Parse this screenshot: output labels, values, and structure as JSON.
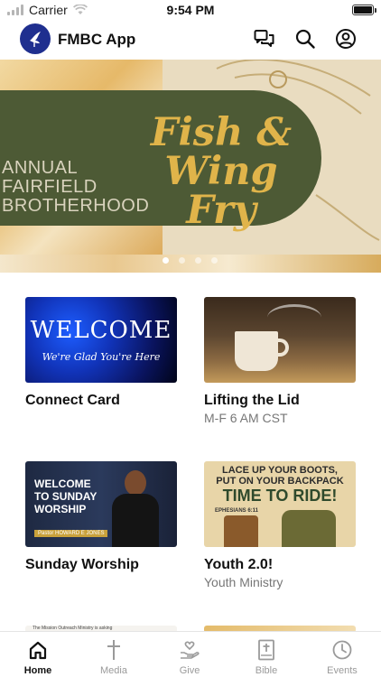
{
  "status_bar": {
    "carrier": "Carrier",
    "time": "9:54 PM"
  },
  "header": {
    "title": "FMBC App",
    "icons": [
      "chat-icon",
      "search-icon",
      "account-icon"
    ]
  },
  "banner": {
    "line1": "ANNUAL",
    "line2": "FAIRFIELD",
    "line3": "BROTHERHOOD",
    "title_line1": "Fish &",
    "title_line2": "Wing",
    "title_line3": "Fry",
    "page_count": 4,
    "active_page": 1,
    "colors": {
      "pill": "#4d5a35",
      "title": "#e0b44a"
    }
  },
  "cards": [
    {
      "title": "Connect Card",
      "subtitle": "",
      "thumb_text": "WELCOME",
      "thumb_subtext": "We're Glad You're Here"
    },
    {
      "title": "Lifting the Lid",
      "subtitle": "M-F 6 AM CST"
    },
    {
      "title": "Sunday Worship",
      "subtitle": "",
      "thumb_line1": "WELCOME",
      "thumb_line2": "TO SUNDAY",
      "thumb_line3": "WORSHIP",
      "thumb_tag": "Pastor HOWARD E JONES"
    },
    {
      "title": "Youth 2.0!",
      "subtitle": "Youth Ministry",
      "thumb_line1": "LACE UP YOUR BOOTS,",
      "thumb_line1b": "PUT ON YOUR BACKPACK",
      "thumb_line2": "TIME TO RIDE!",
      "thumb_line3": "EPHESIANS 6:11"
    },
    {
      "thumb_text": "The Mission Outreach Ministry is asking"
    }
  ],
  "tabs": [
    {
      "label": "Home",
      "icon": "home-icon",
      "active": true
    },
    {
      "label": "Media",
      "icon": "cross-icon",
      "active": false
    },
    {
      "label": "Give",
      "icon": "give-icon",
      "active": false
    },
    {
      "label": "Bible",
      "icon": "bible-icon",
      "active": false
    },
    {
      "label": "Events",
      "icon": "clock-icon",
      "active": false
    }
  ],
  "colors": {
    "logo_bg": "#1f2f8f",
    "tab_inactive": "#9a9a9a",
    "tab_active": "#111111"
  }
}
